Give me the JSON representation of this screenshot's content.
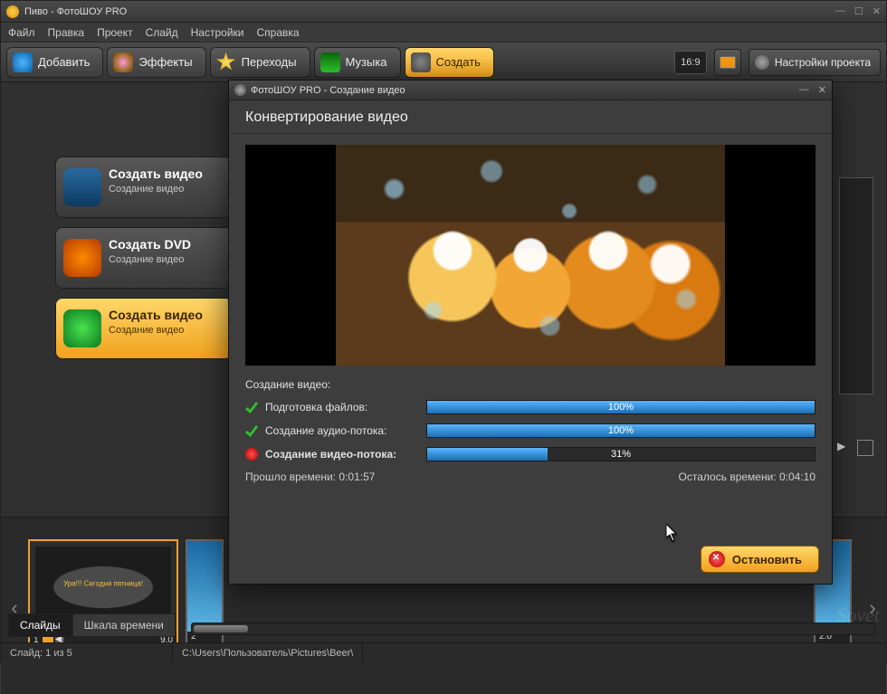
{
  "titlebar": {
    "title": "Пиво - ФотоШОУ PRO"
  },
  "menu": {
    "file": "Файл",
    "edit": "Правка",
    "project": "Проект",
    "slide": "Слайд",
    "settings": "Настройки",
    "help": "Справка"
  },
  "toolbar": {
    "add": "Добавить",
    "effects": "Эффекты",
    "transitions": "Переходы",
    "music": "Музыка",
    "create": "Создать",
    "ratio": "16:9",
    "proj_settings": "Настройки проекта"
  },
  "options": {
    "video": {
      "title": "Создать видео",
      "sub": "Создание видео"
    },
    "dvd": {
      "title": "Создать DVD",
      "sub": "Создание видео"
    },
    "web": {
      "title": "Создать видео",
      "sub": "Создание видео"
    }
  },
  "timeline": {
    "thumb1": {
      "caption": "Ура!!! Сегодня пятница!",
      "num": "1",
      "dur": "9.0"
    },
    "thumb2": {
      "num": "2"
    },
    "thumb3": {
      "dur": "2.0"
    },
    "tabs": {
      "slides": "Слайды",
      "scale": "Шкала времени"
    }
  },
  "status": {
    "slide": "Слайд: 1 из 5",
    "path": "C:\\Users\\Пользователь\\Pictures\\Beer\\"
  },
  "modal": {
    "wintitle": "ФотоШОУ PRO - Создание видео",
    "heading": "Конвертирование видео",
    "section_label": "Создание видео:",
    "rows": {
      "prepare": {
        "label": "Подготовка файлов:",
        "pct": "100%",
        "width": "100%"
      },
      "audio": {
        "label": "Создание аудио-потока:",
        "pct": "100%",
        "width": "100%"
      },
      "video": {
        "label": "Создание видео-потока:",
        "pct": "31%",
        "width": "31%"
      }
    },
    "elapsed": "Прошло времени: 0:01:57",
    "remaining": "Осталось времени: 0:04:10",
    "stop": "Остановить"
  }
}
